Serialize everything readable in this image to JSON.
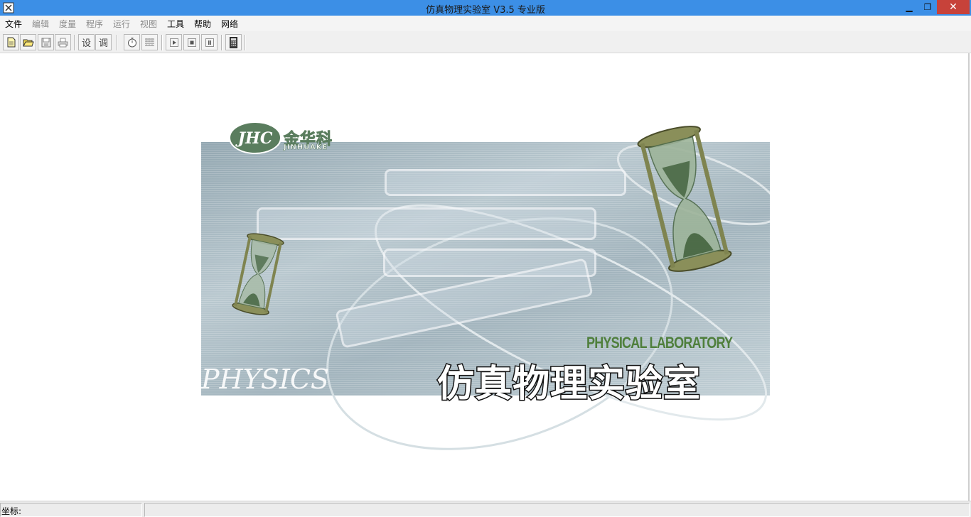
{
  "window": {
    "title": "仿真物理实验室 V3.5 专业版",
    "min_glyph": "▁",
    "max_glyph": "❐",
    "close_glyph": "✕"
  },
  "menu": [
    {
      "label": "文件",
      "enabled": true
    },
    {
      "label": "编辑",
      "enabled": false
    },
    {
      "label": "度量",
      "enabled": false
    },
    {
      "label": "程序",
      "enabled": false
    },
    {
      "label": "运行",
      "enabled": false
    },
    {
      "label": "视图",
      "enabled": false
    },
    {
      "label": "工具",
      "enabled": true
    },
    {
      "label": "帮助",
      "enabled": true
    },
    {
      "label": "网络",
      "enabled": true
    }
  ],
  "toolbar": {
    "set_label": "设",
    "adjust_label": "调"
  },
  "icons": {
    "new": "new-file-icon",
    "open": "open-folder-icon",
    "save": "save-icon",
    "print": "print-icon",
    "timer": "stopwatch-icon",
    "grid": "grid-icon",
    "play": "play-icon",
    "stop": "stop-icon",
    "pause": "pause-icon",
    "calculator": "calculator-icon"
  },
  "splash": {
    "logo_mark": "JHC",
    "logo_text": "金华科",
    "logo_sub": "JINHUAKE",
    "subtitle": "PHYSICAL LABORATORY",
    "title": "仿真物理实验室",
    "physics_text": "PHYSICS"
  },
  "status": {
    "coord_label": "坐标:"
  },
  "colors": {
    "titlebar": "#3c8fe6",
    "close_button": "#c7423a",
    "logo_green": "#5a7d5e",
    "lab_green": "#4f7f3c"
  }
}
